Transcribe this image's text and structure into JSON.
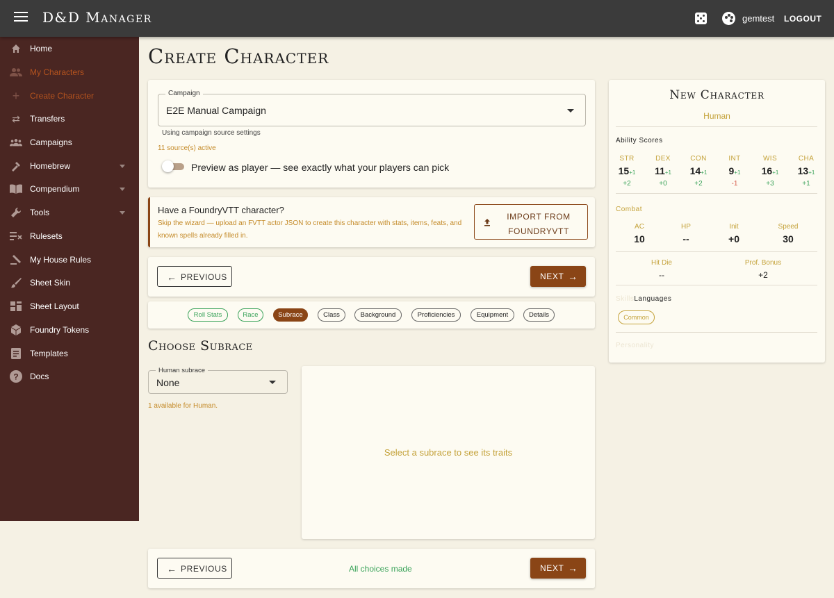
{
  "app": {
    "title": "D&D Manager",
    "username": "gemtest",
    "logout_label": "LOGOUT"
  },
  "sidebar": {
    "items": [
      {
        "label": "Home",
        "icon": "home-icon"
      },
      {
        "label": "My Characters",
        "icon": "people-icon"
      },
      {
        "label": "Create Character",
        "icon": "plus-icon"
      },
      {
        "label": "Transfers",
        "icon": "swap-icon"
      },
      {
        "label": "Campaigns",
        "icon": "group-icon"
      },
      {
        "label": "Homebrew",
        "icon": "flask-icon"
      },
      {
        "label": "Compendium",
        "icon": "book-icon"
      },
      {
        "label": "Tools",
        "icon": "wrench-icon"
      },
      {
        "label": "Rulesets",
        "icon": "rules-icon"
      },
      {
        "label": "My House Rules",
        "icon": "gavel-icon"
      },
      {
        "label": "Sheet Skin",
        "icon": "brush-icon"
      },
      {
        "label": "Sheet Layout",
        "icon": "layout-icon"
      },
      {
        "label": "Foundry Tokens",
        "icon": "cube-icon"
      },
      {
        "label": "Templates",
        "icon": "document-icon"
      },
      {
        "label": "Docs",
        "icon": "help-icon"
      }
    ],
    "active_index": 2,
    "expandable": [
      "Homebrew",
      "Compendium",
      "Tools"
    ]
  },
  "page": {
    "title": "Create Character"
  },
  "campaign": {
    "label": "Campaign",
    "value": "E2E Manual Campaign",
    "helper": "Using campaign source settings",
    "sources_active": "11 source(s) active",
    "preview_label": "Preview as player — see exactly what your players can pick",
    "preview_enabled": false
  },
  "foundry": {
    "title": "Have a FoundryVTT character?",
    "description": "Skip the wizard — upload an FVTT actor JSON to create this character with stats, items, feats, and known spells already filled in.",
    "import_label": "IMPORT FROM FOUNDRYVTT"
  },
  "nav": {
    "previous_label": "PREVIOUS",
    "next_label": "NEXT",
    "all_choices": "All choices made"
  },
  "steps": [
    {
      "label": "Roll Stats",
      "state": "done"
    },
    {
      "label": "Race",
      "state": "done"
    },
    {
      "label": "Subrace",
      "state": "current"
    },
    {
      "label": "Class",
      "state": "pending"
    },
    {
      "label": "Background",
      "state": "pending"
    },
    {
      "label": "Proficiencies",
      "state": "pending"
    },
    {
      "label": "Equipment",
      "state": "pending"
    },
    {
      "label": "Details",
      "state": "pending"
    }
  ],
  "subrace": {
    "section_title": "Choose Subrace",
    "select_label": "Human subrace",
    "select_value": "None",
    "helper": "1 available for Human.",
    "placeholder": "Select a subrace to see its traits"
  },
  "character": {
    "title": "New Character",
    "race": "Human",
    "ability_label": "Ability Scores",
    "abilities": [
      {
        "name": "STR",
        "score": "15",
        "bonus": "+1",
        "mod": "+2"
      },
      {
        "name": "DEX",
        "score": "11",
        "bonus": "+1",
        "mod": "+0"
      },
      {
        "name": "CON",
        "score": "14",
        "bonus": "+1",
        "mod": "+2"
      },
      {
        "name": "INT",
        "score": "9",
        "bonus": "+1",
        "mod": "-1"
      },
      {
        "name": "WIS",
        "score": "16",
        "bonus": "+1",
        "mod": "+3"
      },
      {
        "name": "CHA",
        "score": "13",
        "bonus": "+1",
        "mod": "+1"
      }
    ],
    "combat_label": "Combat",
    "combat": [
      {
        "name": "AC",
        "value": "10"
      },
      {
        "name": "HP",
        "value": "--"
      },
      {
        "name": "Init",
        "value": "+0"
      },
      {
        "name": "Speed",
        "value": "30"
      }
    ],
    "hit_die_label": "Hit Die",
    "hit_die": "--",
    "prof_label": "Prof. Bonus",
    "prof": "+2",
    "skills_label": "Skills",
    "languages_label": "Languages",
    "languages": [
      "Common"
    ],
    "personality_label": "Personality"
  },
  "colors": {
    "accent": "#8a4516",
    "sidebar": "#4a2622",
    "topbar": "#3b3b3b",
    "success": "#3aa35a",
    "gold": "#c4a23a"
  }
}
